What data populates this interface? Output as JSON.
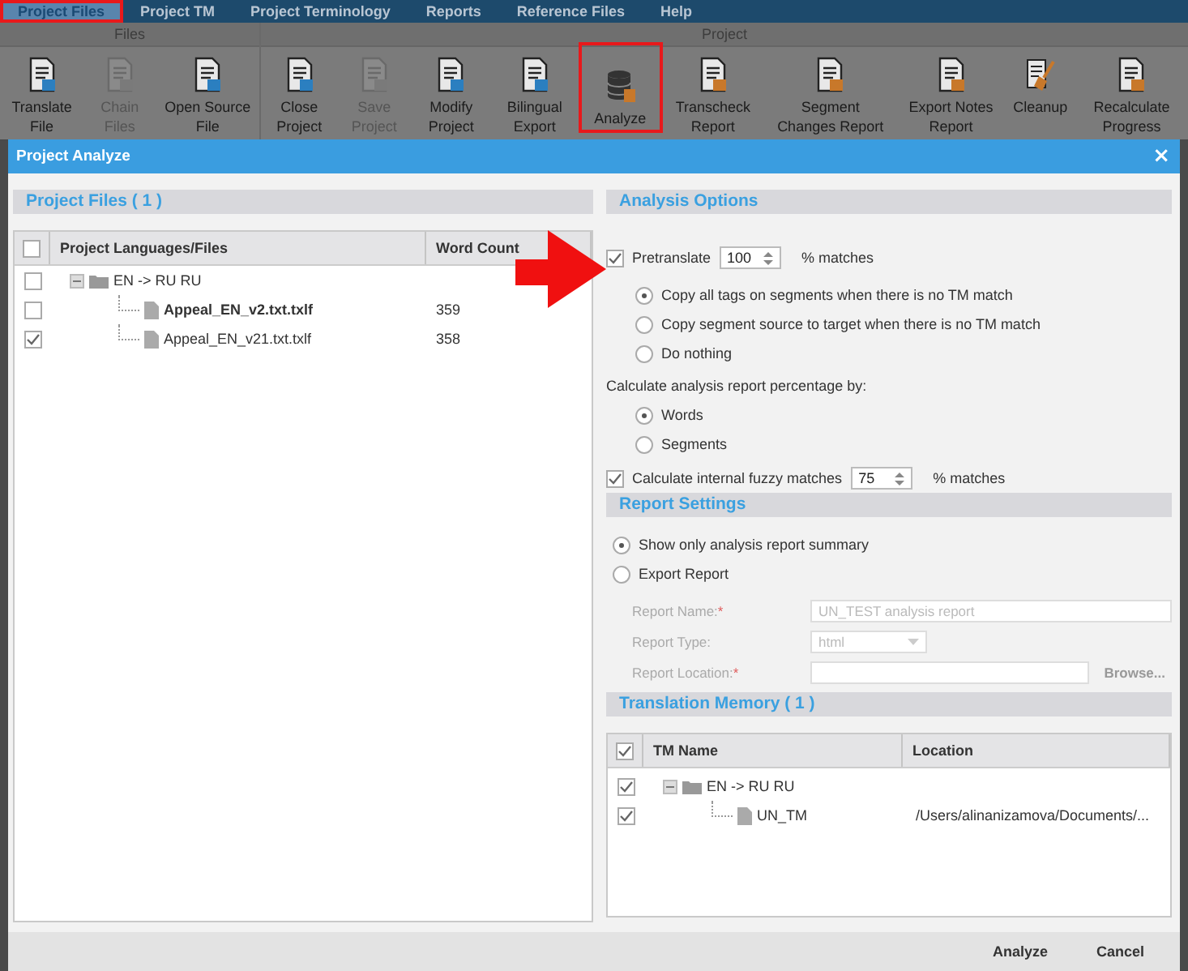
{
  "menu_tabs": [
    {
      "label": "Project Files",
      "selected": true,
      "highlighted": true
    },
    {
      "label": "Project TM",
      "selected": false,
      "highlighted": false
    },
    {
      "label": "Project Terminology",
      "selected": false,
      "highlighted": false
    },
    {
      "label": "Reports",
      "selected": false,
      "highlighted": false
    },
    {
      "label": "Reference Files",
      "selected": false,
      "highlighted": false
    },
    {
      "label": "Help",
      "selected": false,
      "highlighted": false
    }
  ],
  "ribbon_groups": [
    {
      "label": "Files",
      "buttons": [
        {
          "label": "Translate File",
          "disabled": false,
          "highlighted": false
        },
        {
          "label": "Chain Files",
          "disabled": true,
          "highlighted": false
        },
        {
          "label": "Open Source File",
          "disabled": false,
          "highlighted": false
        }
      ]
    },
    {
      "label": "Project",
      "buttons": [
        {
          "label": "Close Project",
          "disabled": false,
          "highlighted": false
        },
        {
          "label": "Save Project",
          "disabled": true,
          "highlighted": false
        },
        {
          "label": "Modify Project",
          "disabled": false,
          "highlighted": false
        },
        {
          "label": "Bilingual Export",
          "disabled": false,
          "highlighted": false
        },
        {
          "label": "Analyze",
          "disabled": false,
          "highlighted": true
        },
        {
          "label": "Transcheck Report",
          "disabled": false,
          "highlighted": false
        },
        {
          "label": "Segment Changes Report",
          "disabled": false,
          "highlighted": false
        },
        {
          "label": "Export Notes Report",
          "disabled": false,
          "highlighted": false
        },
        {
          "label": "Cleanup",
          "disabled": false,
          "highlighted": false
        },
        {
          "label": "Recalculate Progress",
          "disabled": false,
          "highlighted": false
        }
      ]
    }
  ],
  "dialog": {
    "title": "Project Analyze",
    "close": "×",
    "project_files": {
      "title": "Project Files ( 1 )",
      "header_checked": false,
      "columns": [
        "Project Languages/Files",
        "Word Count"
      ],
      "tree": [
        {
          "kind": "folder",
          "name": "EN -> RU RU",
          "checked": false,
          "expanded": true,
          "children": [
            {
              "kind": "file",
              "name": "Appeal_EN_v2.txt.txlf",
              "checked": false,
              "bold": true,
              "word_count": "359"
            },
            {
              "kind": "file",
              "name": "Appeal_EN_v21.txt.txlf",
              "checked": true,
              "bold": false,
              "word_count": "358"
            }
          ]
        }
      ]
    },
    "analysis_options": {
      "title": "Analysis Options",
      "pretranslate": {
        "label": "Pretranslate",
        "checked": true,
        "value": "100",
        "suffix": "% matches"
      },
      "pretranslate_options": [
        {
          "label": "Copy all tags on segments when there is no TM match",
          "selected": true
        },
        {
          "label": "Copy segment source to target when there is no TM match",
          "selected": false
        },
        {
          "label": "Do nothing",
          "selected": false
        }
      ],
      "percentage_label": "Calculate analysis report percentage by:",
      "percentage_options": [
        {
          "label": "Words",
          "selected": true
        },
        {
          "label": "Segments",
          "selected": false
        }
      ],
      "fuzzy": {
        "label": "Calculate internal fuzzy matches",
        "checked": true,
        "value": "75",
        "suffix": "% matches"
      }
    },
    "report_settings": {
      "title": "Report Settings",
      "options": [
        {
          "label": "Show only analysis report summary",
          "selected": true
        },
        {
          "label": "Export Report",
          "selected": false
        }
      ],
      "fields": [
        {
          "kind": "text",
          "label": "Report Name:",
          "mark": "*",
          "value": "UN_TEST  analysis  report",
          "disabled": true
        },
        {
          "kind": "select",
          "label": "Report Type:",
          "value": "html",
          "disabled": true
        },
        {
          "kind": "browse",
          "label": "Report Location:",
          "mark": "*",
          "button": "Browse...",
          "disabled": true
        }
      ]
    },
    "translation_memory": {
      "title": "Translation Memory ( 1 )",
      "header_checked": true,
      "columns": [
        "TM Name",
        "Location"
      ],
      "tree": [
        {
          "kind": "folder",
          "name": "EN -> RU RU",
          "checked": true,
          "expanded": true,
          "children": [
            {
              "kind": "file",
              "name": "UN_TM",
              "checked": true,
              "location": "/Users/alinanizamova/Documents/..."
            }
          ]
        }
      ]
    },
    "buttons": [
      "Analyze",
      "Cancel"
    ]
  },
  "annotation_arrow": true
}
